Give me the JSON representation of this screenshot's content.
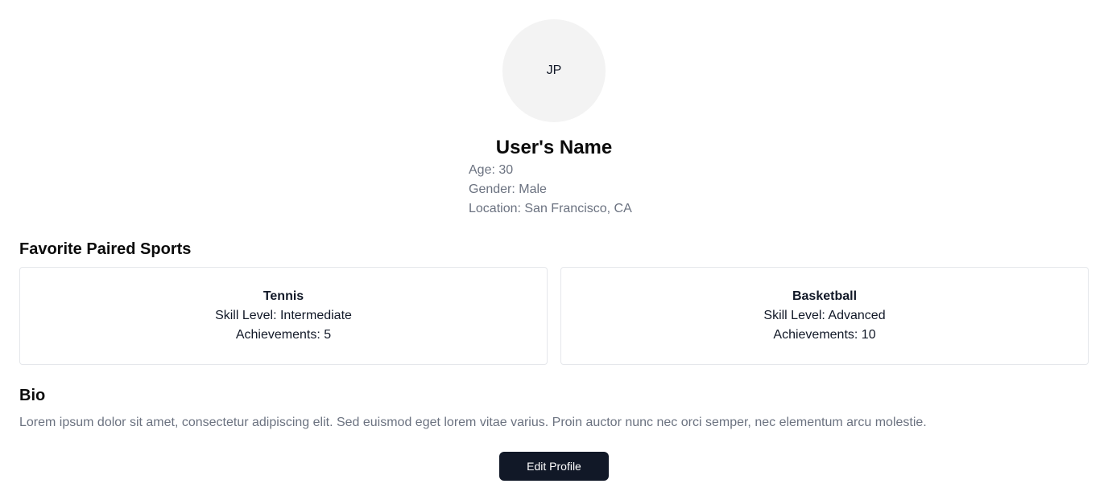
{
  "profile": {
    "avatar_initials": "JP",
    "name": "User's Name",
    "age": "Age: 30",
    "gender": "Gender: Male",
    "location": "Location: San Francisco, CA"
  },
  "sports": {
    "title": "Favorite Paired Sports",
    "items": [
      {
        "name": "Tennis",
        "skill": "Skill Level: Intermediate",
        "achievements": "Achievements: 5"
      },
      {
        "name": "Basketball",
        "skill": "Skill Level: Advanced",
        "achievements": "Achievements: 10"
      }
    ]
  },
  "bio": {
    "title": "Bio",
    "text": "Lorem ipsum dolor sit amet, consectetur adipiscing elit. Sed euismod eget lorem vitae varius. Proin auctor nunc nec orci semper, nec elementum arcu molestie."
  },
  "actions": {
    "edit_label": "Edit Profile"
  },
  "colors": {
    "button_bg": "#111827",
    "muted_text": "#6b7280",
    "avatar_bg": "#f3f3f3",
    "card_border": "#e5e7eb"
  }
}
